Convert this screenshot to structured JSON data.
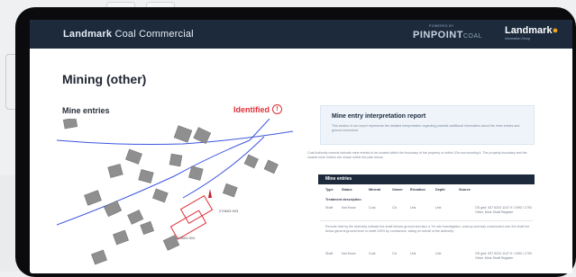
{
  "app": {
    "brand_bold": "Landmark",
    "brand_rest": "Coal Commercial",
    "powered_by": "POWERED BY",
    "pinpoint_logo": "PINPOINT",
    "pinpoint_suffix": "COAL",
    "landmark_logo": "Landmark",
    "landmark_sub": "Information Group"
  },
  "page": {
    "title": "Mining (other)"
  },
  "map_panel": {
    "label": "Mine entries",
    "status": "Identified",
    "status_icon": "alert-circle-icon",
    "status_color": "#e0303a",
    "markers": [
      "270603 003",
      "270603 004"
    ]
  },
  "report": {
    "title": "Mine entry interpretation report",
    "body": "This section of our report represents the detailed interpretation regarding possible additional information about the mine entries and ground movement.",
    "paragraph": "Coal Authority records indicate mine entries to be located within the boundary of the property or within 20m surrounding it. The property boundary and the closest mine entries are shown within the plan below."
  },
  "table": {
    "title": "Mine entries",
    "columns": [
      "Type",
      "Status",
      "Mineral",
      "Owner",
      "Elevation",
      "Depth",
      "Source"
    ],
    "section_label": "Treatment description",
    "rows": [
      [
        "Shaft",
        "Not Know",
        "Coal",
        "CA",
        "Unk",
        "Unk",
        "OS grid: 007 5224 1147.9 / 1993 / 1793 Other, Mine Shaft Register"
      ],
      [
        "Shaft",
        "Not Know",
        "Coal",
        "CA",
        "Unk",
        "Unk",
        "OS grid: 007 5224 1147.9 / 1993 / 1793 Other, Mine Shaft Register"
      ]
    ],
    "note": "Remote held by the Authority indicate the shaft follows ground and also a 7m site investigation, outcrop and was constructed over the shaft the below general ground level or shaft 100% by contractors, acting on behalf of the Authority."
  }
}
